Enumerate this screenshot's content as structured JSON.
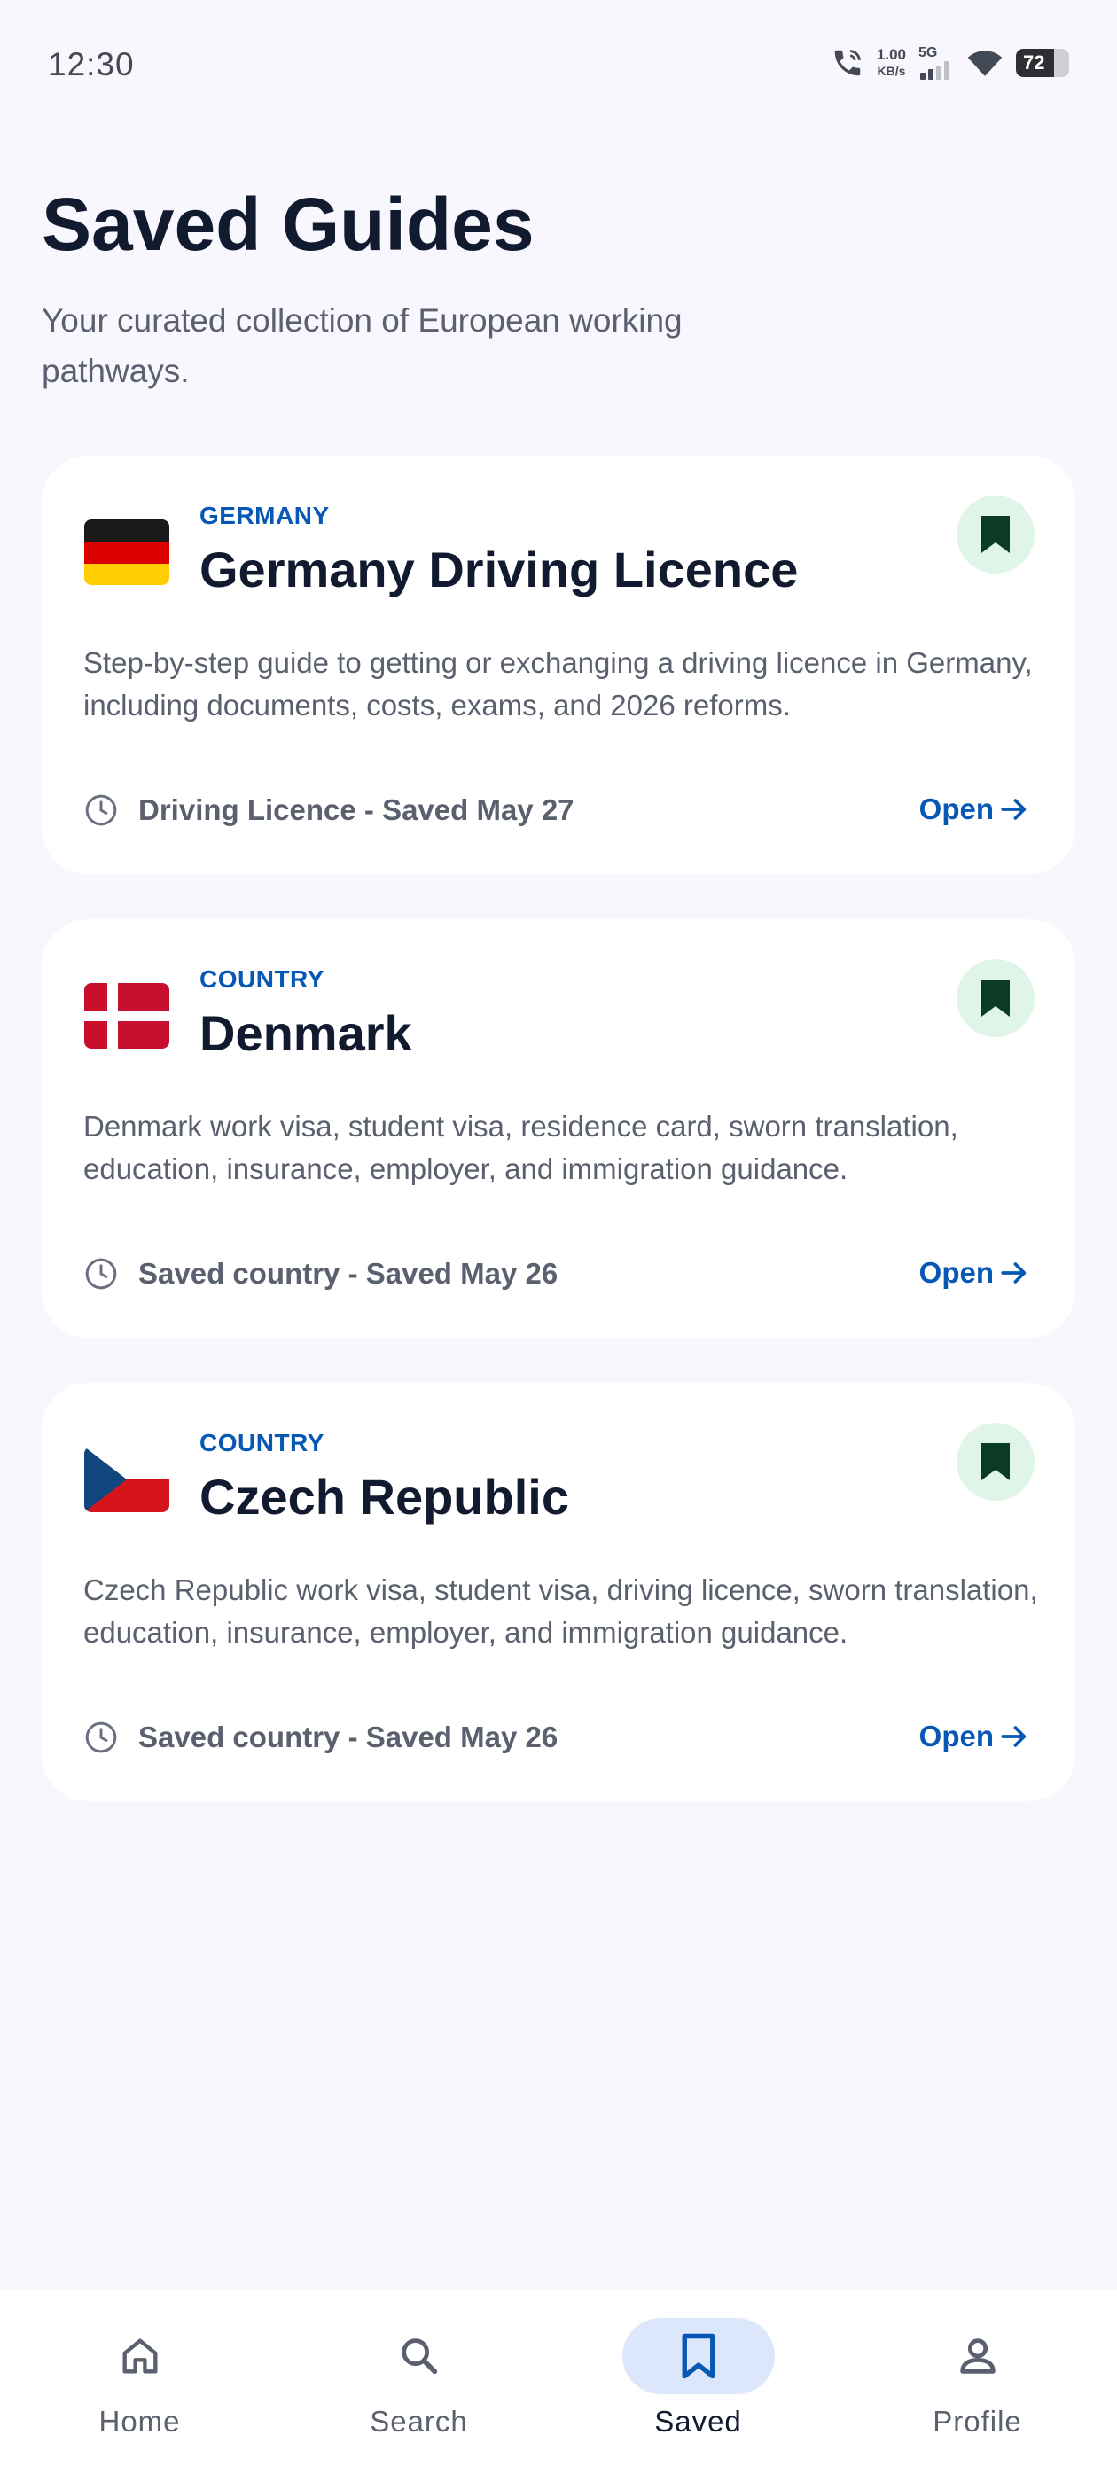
{
  "status_bar": {
    "time": "12:30",
    "net_speed_value": "1.00",
    "net_speed_unit": "KB/s",
    "network_type": "5G",
    "battery_percent": "72",
    "battery_level": 0.72
  },
  "header": {
    "title": "Saved Guides",
    "subtitle": "Your curated collection of European working pathways."
  },
  "cards": [
    {
      "flag": "germany-flag",
      "category": "GERMANY",
      "title": "Germany Driving Licence",
      "description": "Step-by-step guide to getting or exchanging a driving licence in Germany, including documents, costs, exams, and 2026 reforms.",
      "meta": "Driving Licence - Saved May 27",
      "open_label": "Open"
    },
    {
      "flag": "denmark-flag",
      "category": "COUNTRY",
      "title": "Denmark",
      "description": "Denmark work visa, student visa, residence card, sworn translation, education, insurance, employer, and immigration guidance.",
      "meta": "Saved country - Saved May 26",
      "open_label": "Open"
    },
    {
      "flag": "czech-republic-flag",
      "category": "COUNTRY",
      "title": "Czech Republic",
      "description": "Czech Republic work visa, student visa, driving licence, sworn translation, education, insurance, employer, and immigration guidance.",
      "meta": "Saved country - Saved May 26",
      "open_label": "Open"
    }
  ],
  "nav": {
    "items": [
      {
        "label": "Home",
        "icon": "home-icon"
      },
      {
        "label": "Search",
        "icon": "search-icon"
      },
      {
        "label": "Saved",
        "icon": "bookmark-icon",
        "active": true
      },
      {
        "label": "Profile",
        "icon": "person-icon"
      }
    ]
  },
  "colors": {
    "accent": "#0757b5",
    "background": "#f7f7fd",
    "bookmark_bg": "#dff5e8",
    "bookmark_fg": "#0b3a26",
    "nav_active_bg": "#dde7fb"
  }
}
